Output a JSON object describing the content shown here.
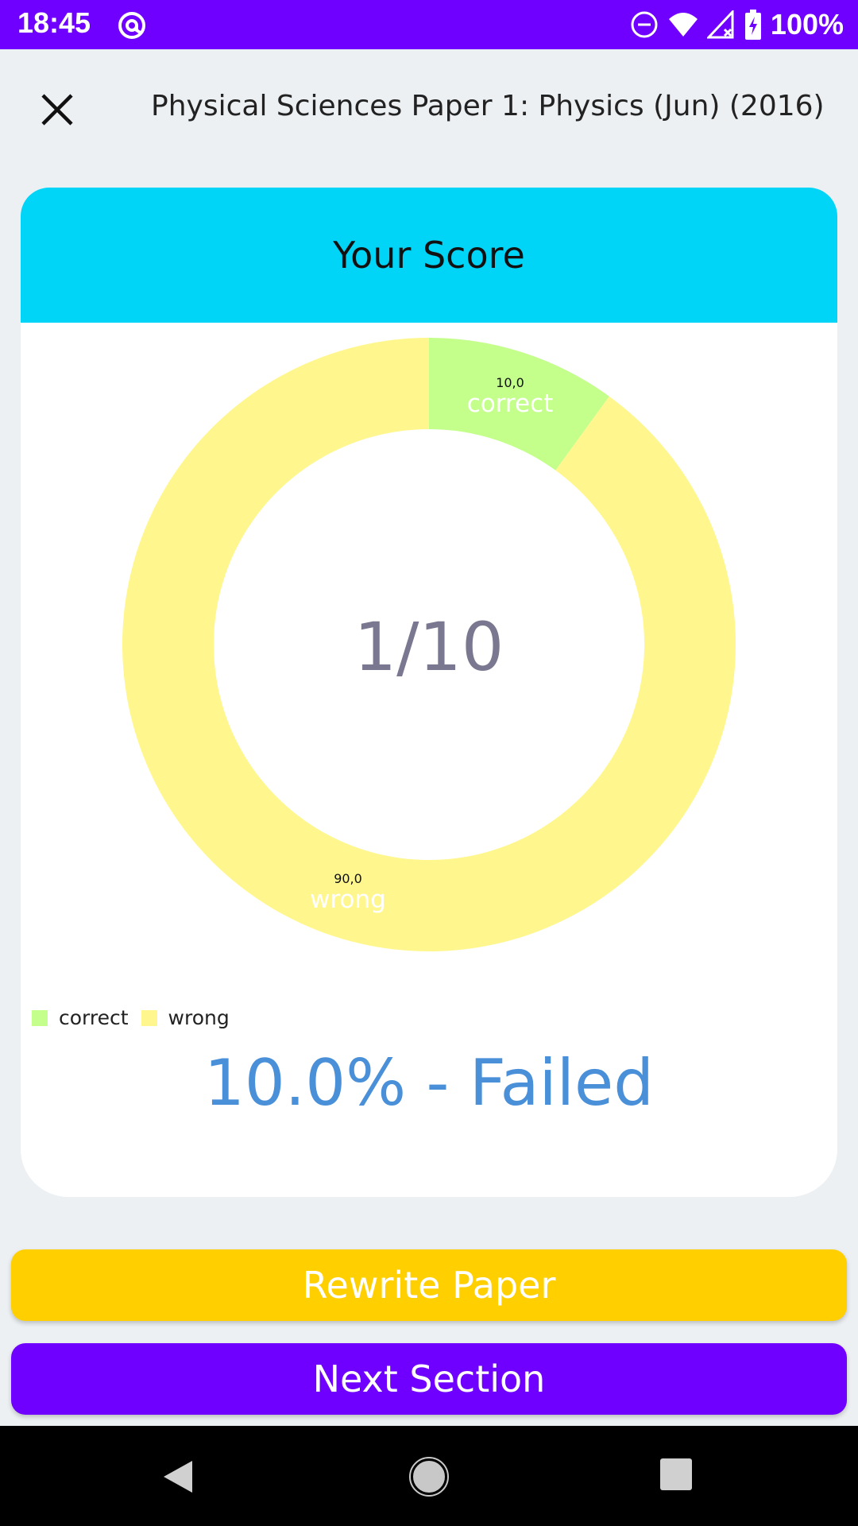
{
  "status_bar": {
    "time": "18:45",
    "battery": "100%"
  },
  "header": {
    "title": "Physical Sciences Paper 1: Physics (Jun) (2016)"
  },
  "card": {
    "title": "Your Score",
    "score": "1/10",
    "result": "10.0% - Failed"
  },
  "chart_data": {
    "type": "pie",
    "slices": [
      {
        "label": "correct",
        "value": 10.0,
        "value_label": "10,0",
        "color": "#C3FF8A"
      },
      {
        "label": "wrong",
        "value": 90.0,
        "value_label": "90,0",
        "color": "#FFF78E"
      }
    ],
    "legend": [
      "correct",
      "wrong"
    ],
    "legend_placement": "bottom-left",
    "center_text": "1/10"
  },
  "buttons": {
    "rewrite": "Rewrite Paper",
    "next": "Next Section"
  },
  "colors": {
    "status_bar": "#6F00FF",
    "card_header": "#00D4F7",
    "rewrite_button": "#FFCF00",
    "next_button": "#6F00FF",
    "result_text": "#4A90D9"
  }
}
